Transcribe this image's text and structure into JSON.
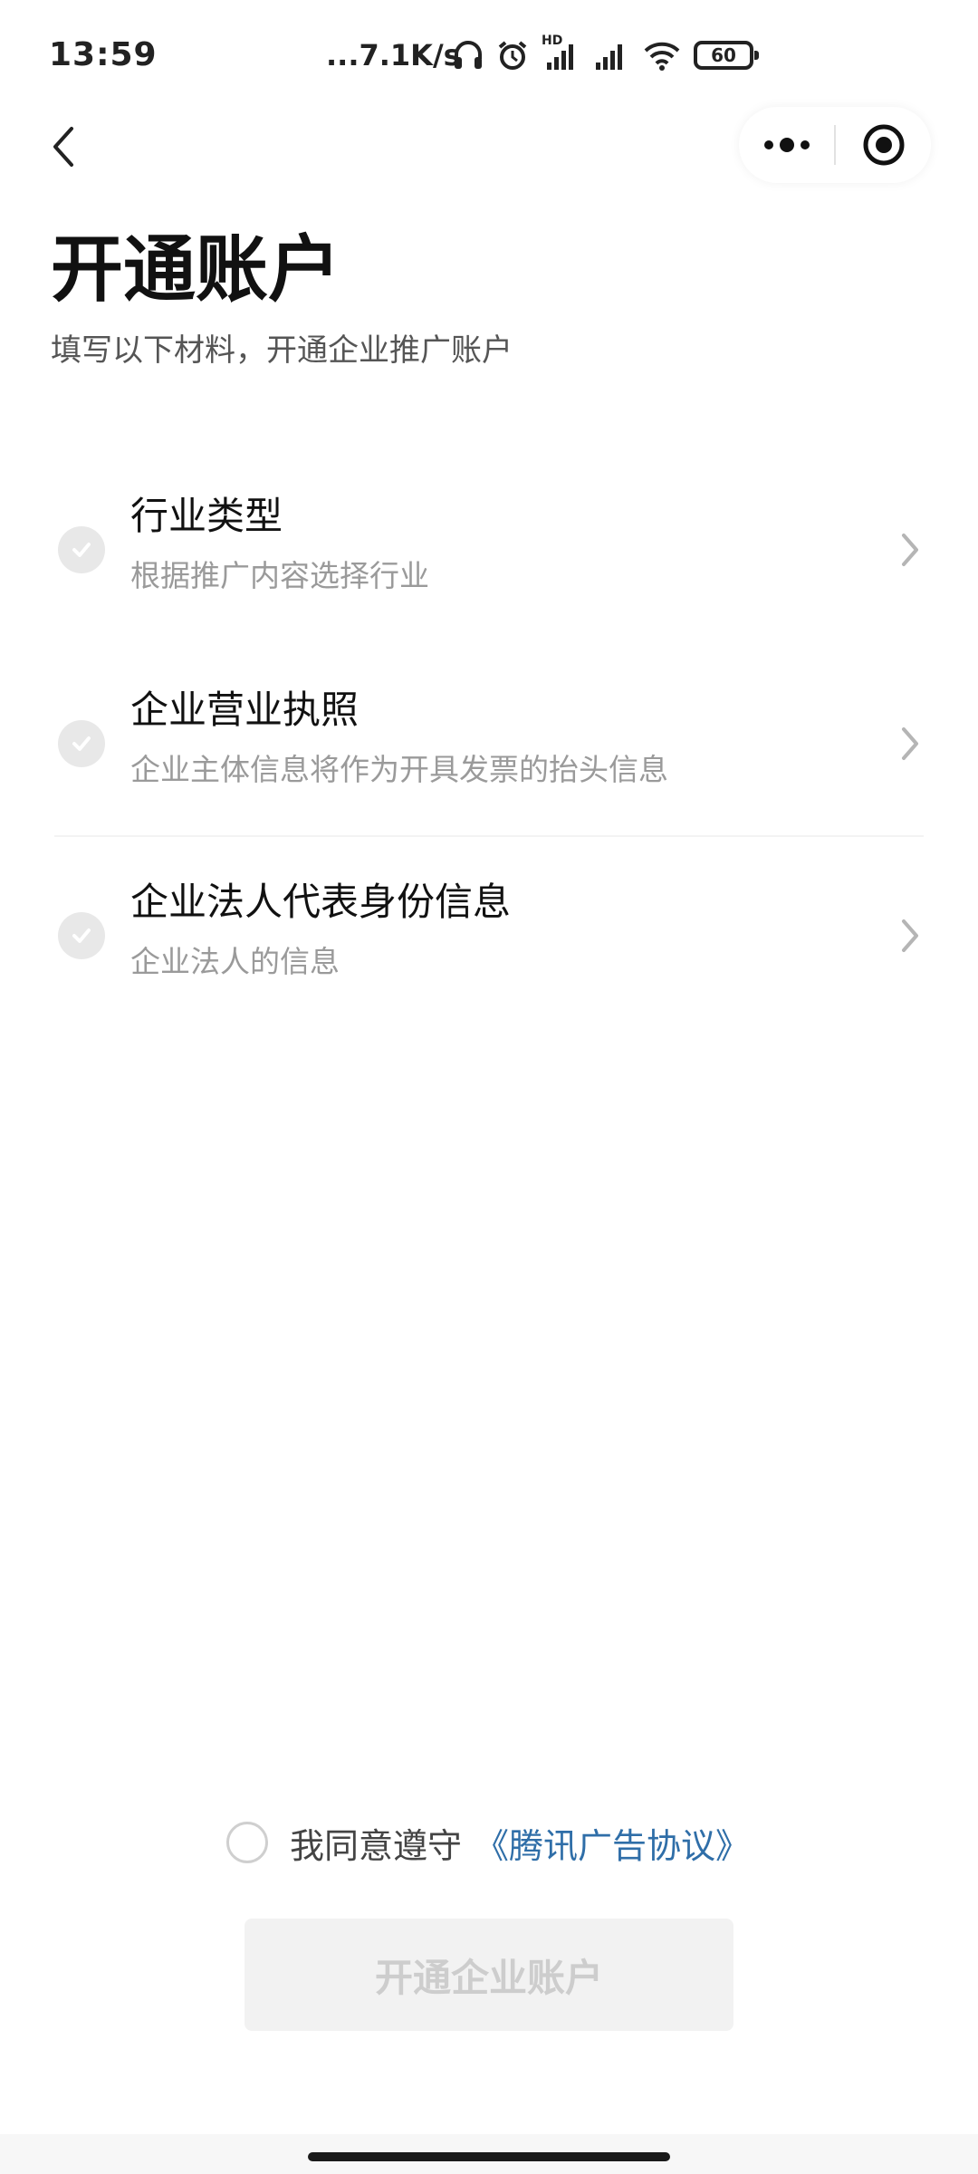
{
  "status_bar": {
    "time": "13:59",
    "network_speed": "...7.1K/s",
    "hd_label": "HD",
    "battery": "60"
  },
  "header": {
    "title": "开通账户",
    "subtitle": "填写以下材料，开通企业推广账户"
  },
  "steps": [
    {
      "title": "行业类型",
      "description": "根据推广内容选择行业"
    },
    {
      "title": "企业营业执照",
      "description": "企业主体信息将作为开具发票的抬头信息"
    },
    {
      "title": "企业法人代表身份信息",
      "description": "企业法人的信息"
    }
  ],
  "agreement": {
    "text": "我同意遵守",
    "link_text": "《腾讯广告协议》",
    "link_color": "#2f6ea8"
  },
  "submit": {
    "label": "开通企业账户"
  },
  "icons": {
    "back": "chevron-left-icon",
    "more": "more-dots-icon",
    "close": "target-close-icon",
    "step_status": "check-circle-icon",
    "step_arrow": "chevron-right-icon"
  },
  "colors": {
    "link": "#2f6ea8",
    "disabled_button_bg": "#f2f2f2",
    "disabled_button_text": "#cdcdcd",
    "check_circle": "#e8e8e8"
  }
}
